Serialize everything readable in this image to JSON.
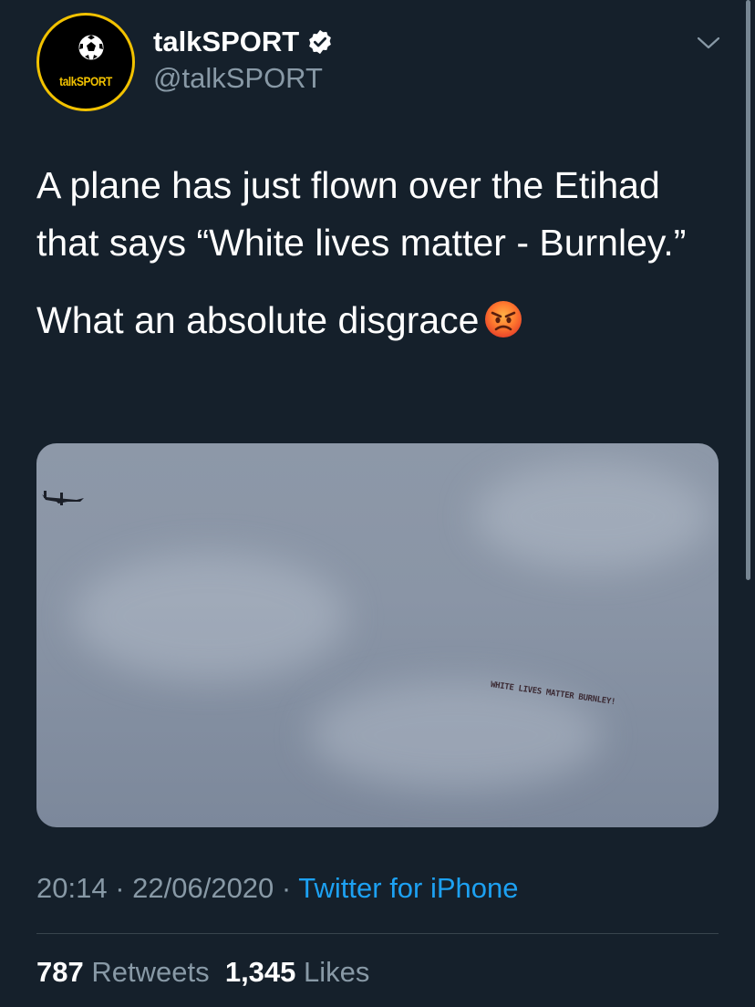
{
  "author": {
    "display_name": "talkSPORT",
    "handle": "@talkSPORT",
    "avatar_text": "talkSPORT",
    "verified": true,
    "verified_icon": "verified-badge-icon"
  },
  "tweet": {
    "paragraph_1": "A plane has just flown over the Etihad that says “White lives matter - Burnley.”",
    "paragraph_2": "What an absolute disgrace",
    "emoji": "angry-face-emoji"
  },
  "media": {
    "banner_text": "WHITE LIVES MATTER BURNLEY!"
  },
  "meta": {
    "time": "20:14",
    "separator": " · ",
    "date": "22/06/2020",
    "source": "Twitter for iPhone"
  },
  "stats": {
    "retweets_count": "787",
    "retweets_label": "Retweets",
    "likes_count": "1,345",
    "likes_label": "Likes"
  },
  "colors": {
    "background": "#15202b",
    "secondary_text": "#8899a6",
    "link": "#1da1f2",
    "brand_yellow": "#f2c200"
  }
}
